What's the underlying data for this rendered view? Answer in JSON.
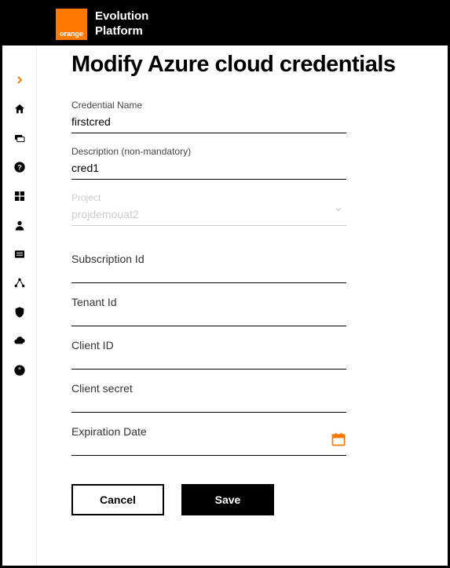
{
  "header": {
    "logo_text": "orange",
    "brand_line1": "Evolution",
    "brand_line2": "Platform"
  },
  "page": {
    "title": "Modify Azure cloud credentials"
  },
  "form": {
    "credential_name": {
      "label": "Credential Name",
      "value": "firstcred"
    },
    "description": {
      "label": "Description (non-mandatory)",
      "value": "cred1"
    },
    "project": {
      "label": "Project",
      "value": "projdemouat2"
    },
    "subscription_id": {
      "label": "Subscription Id",
      "value": ""
    },
    "tenant_id": {
      "label": "Tenant Id",
      "value": ""
    },
    "client_id": {
      "label": "Client ID",
      "value": ""
    },
    "client_secret": {
      "label": "Client secret",
      "value": ""
    },
    "expiration_date": {
      "label": "Expiration Date",
      "value": ""
    }
  },
  "buttons": {
    "cancel": "Cancel",
    "save": "Save"
  },
  "colors": {
    "accent": "#ff7900"
  }
}
